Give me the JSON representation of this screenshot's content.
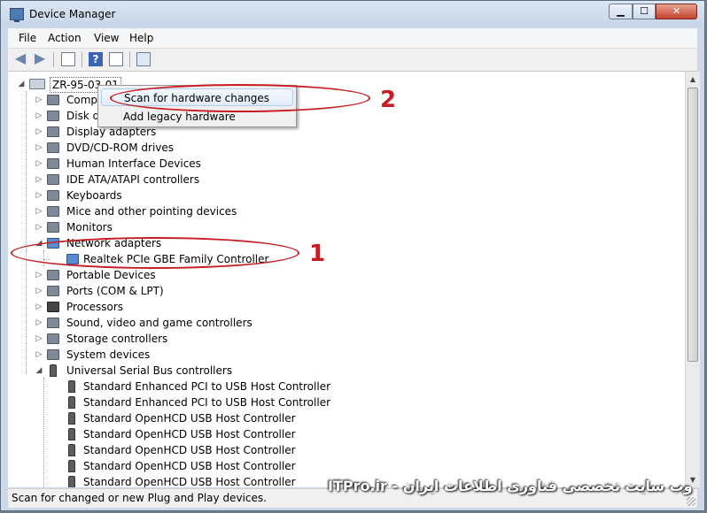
{
  "window": {
    "title": "Device Manager",
    "min": "▁",
    "max": "☐",
    "close": "✕"
  },
  "menu": [
    "File",
    "Action",
    "View",
    "Help"
  ],
  "toolbar": {
    "back_icon": "back-arrow-icon",
    "forward_icon": "forward-arrow-icon",
    "help_glyph": "?"
  },
  "tree": {
    "root": "ZR-95-03-01",
    "items": [
      {
        "label": "Computer",
        "icon": "computer-icon",
        "state": "collapsed"
      },
      {
        "label": "Disk drives",
        "icon": "disk-icon",
        "state": "collapsed"
      },
      {
        "label": "Display adapters",
        "icon": "display-icon",
        "state": "collapsed"
      },
      {
        "label": "DVD/CD-ROM drives",
        "icon": "dvd-icon",
        "state": "collapsed"
      },
      {
        "label": "Human Interface Devices",
        "icon": "hid-icon",
        "state": "collapsed"
      },
      {
        "label": "IDE ATA/ATAPI controllers",
        "icon": "ide-icon",
        "state": "collapsed"
      },
      {
        "label": "Keyboards",
        "icon": "keyboard-icon",
        "state": "collapsed"
      },
      {
        "label": "Mice and other pointing devices",
        "icon": "mouse-icon",
        "state": "collapsed"
      },
      {
        "label": "Monitors",
        "icon": "monitor-icon",
        "state": "collapsed"
      },
      {
        "label": "Network adapters",
        "icon": "network-icon",
        "state": "expanded"
      },
      {
        "label": "Realtek PCIe GBE Family Controller",
        "icon": "nic-icon",
        "state": "child"
      },
      {
        "label": "Portable Devices",
        "icon": "portable-icon",
        "state": "collapsed"
      },
      {
        "label": "Ports (COM & LPT)",
        "icon": "port-icon",
        "state": "collapsed"
      },
      {
        "label": "Processors",
        "icon": "cpu-icon",
        "state": "collapsed"
      },
      {
        "label": "Sound, video and game controllers",
        "icon": "sound-icon",
        "state": "collapsed"
      },
      {
        "label": "Storage controllers",
        "icon": "storage-icon",
        "state": "collapsed"
      },
      {
        "label": "System devices",
        "icon": "system-icon",
        "state": "collapsed"
      },
      {
        "label": "Universal Serial Bus controllers",
        "icon": "usb-icon",
        "state": "expanded"
      },
      {
        "label": "Standard Enhanced PCI to USB Host Controller",
        "icon": "usb-plug-icon",
        "state": "child"
      },
      {
        "label": "Standard Enhanced PCI to USB Host Controller",
        "icon": "usb-plug-icon",
        "state": "child"
      },
      {
        "label": "Standard OpenHCD USB Host Controller",
        "icon": "usb-plug-icon",
        "state": "child"
      },
      {
        "label": "Standard OpenHCD USB Host Controller",
        "icon": "usb-plug-icon",
        "state": "child"
      },
      {
        "label": "Standard OpenHCD USB Host Controller",
        "icon": "usb-plug-icon",
        "state": "child"
      },
      {
        "label": "Standard OpenHCD USB Host Controller",
        "icon": "usb-plug-icon",
        "state": "child"
      },
      {
        "label": "Standard OpenHCD USB Host Controller",
        "icon": "usb-plug-icon",
        "state": "child"
      }
    ]
  },
  "context_menu": {
    "items": [
      "Scan for hardware changes",
      "Add legacy hardware"
    ],
    "highlighted": "Scan for hardware changes"
  },
  "annotations": {
    "label_1": "1",
    "label_2": "2",
    "color": "#c61d23"
  },
  "status": "Scan for changed or new Plug and Play devices.",
  "watermark": "ITPro.ir - وب سایت تخصصی فناوری اطلاعات ایران"
}
